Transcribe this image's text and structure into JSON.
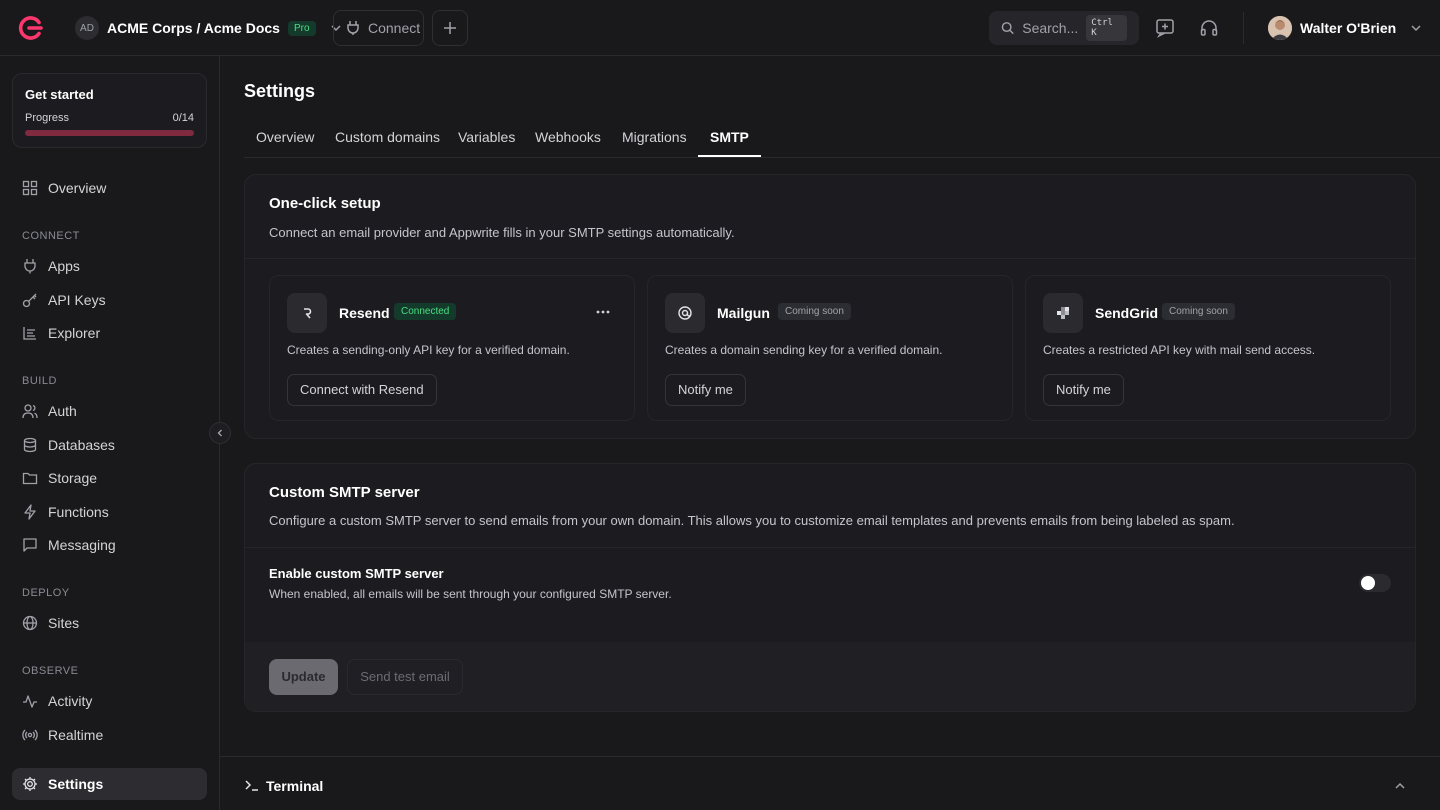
{
  "topbar": {
    "org_initials": "AD",
    "org_name": "ACME Corps / Acme Docs",
    "plan_badge": "Pro",
    "connect_label": "Connect",
    "search_placeholder": "Search...",
    "search_shortcut": "Ctrl K",
    "user_name": "Walter O'Brien"
  },
  "get_started": {
    "title": "Get started",
    "progress_label": "Progress",
    "progress_count": "0/14",
    "progress_fraction": 0
  },
  "sidebar": {
    "overview": "Overview",
    "connect_header": "CONNECT",
    "apps": "Apps",
    "api_keys": "API Keys",
    "explorer": "Explorer",
    "build_header": "BUILD",
    "auth": "Auth",
    "databases": "Databases",
    "storage": "Storage",
    "functions": "Functions",
    "messaging": "Messaging",
    "deploy_header": "DEPLOY",
    "sites": "Sites",
    "observe_header": "OBSERVE",
    "activity": "Activity",
    "realtime": "Realtime",
    "settings": "Settings"
  },
  "page": {
    "title": "Settings",
    "tabs": [
      "Overview",
      "Custom domains",
      "Variables",
      "Webhooks",
      "Migrations",
      "SMTP"
    ],
    "active_tab": "SMTP"
  },
  "one_click": {
    "title": "One-click setup",
    "description": "Connect an email provider and Appwrite fills in your SMTP settings automatically.",
    "providers": [
      {
        "name": "Resend",
        "badge": "Connected",
        "description": "Creates a sending-only API key for a verified domain.",
        "button": "Connect with Resend",
        "icon": "resend-icon"
      },
      {
        "name": "Mailgun",
        "badge": "Coming soon",
        "description": "Creates a domain sending key for a verified domain.",
        "button": "Notify me",
        "icon": "mailgun-icon"
      },
      {
        "name": "SendGrid",
        "badge": "Coming soon",
        "description": "Creates a restricted API key with mail send access.",
        "button": "Notify me",
        "icon": "sendgrid-icon"
      }
    ]
  },
  "custom_smtp": {
    "title": "Custom SMTP server",
    "description": "Configure a custom SMTP server to send emails from your own domain. This allows you to customize email templates and prevents emails from being labeled as spam.",
    "enable_label": "Enable custom SMTP server",
    "enable_help": "When enabled, all emails will be sent through your configured SMTP server.",
    "enabled": false,
    "update_button": "Update",
    "test_button": "Send test email"
  },
  "terminal": {
    "label": "Terminal"
  },
  "colors": {
    "brand": "#fd366e",
    "background": "#19191c",
    "success": "#4ade80"
  }
}
